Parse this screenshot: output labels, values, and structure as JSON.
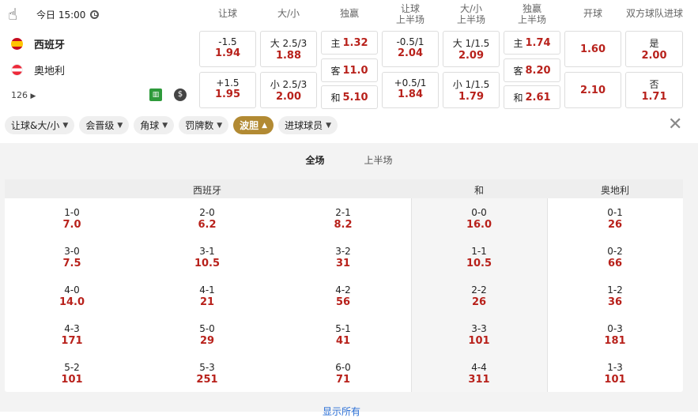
{
  "match": {
    "time": "今日 15:00",
    "home": "西班牙",
    "away": "奥地利",
    "more_markets": "126"
  },
  "icons": [
    "hand-cursor-icon",
    "clock-icon",
    "spain-flag-icon",
    "austria-flag-icon",
    "stats-icon",
    "dollar-icon",
    "close-icon"
  ],
  "columns": {
    "handicap": "让球",
    "ou": "大/小",
    "moneyline": "独赢",
    "handicap_1h_a": "让球",
    "handicap_1h_b": "上半场",
    "ou_1h_a": "大/小",
    "ou_1h_b": "上半场",
    "ml_1h_a": "独赢",
    "ml_1h_b": "上半场",
    "first_kick": "开球",
    "btts": "双方球队进球"
  },
  "odds": {
    "handicap": [
      {
        "line": "-1.5",
        "odd": "1.94"
      },
      {
        "line": "+1.5",
        "odd": "1.95"
      }
    ],
    "ou": [
      {
        "line": "大 2.5/3",
        "odd": "1.88"
      },
      {
        "line": "小 2.5/3",
        "odd": "2.00"
      }
    ],
    "moneyline": [
      {
        "line": "主",
        "odd": "1.32"
      },
      {
        "line": "客",
        "odd": "11.0"
      },
      {
        "line": "和",
        "odd": "5.10"
      }
    ],
    "handicap_1h": [
      {
        "line": "-0.5/1",
        "odd": "2.04"
      },
      {
        "line": "+0.5/1",
        "odd": "1.84"
      }
    ],
    "ou_1h": [
      {
        "line": "大 1/1.5",
        "odd": "2.09"
      },
      {
        "line": "小 1/1.5",
        "odd": "1.79"
      }
    ],
    "ml_1h": [
      {
        "line": "主",
        "odd": "1.74"
      },
      {
        "line": "客",
        "odd": "8.20"
      },
      {
        "line": "和",
        "odd": "2.61"
      }
    ],
    "first_kick": [
      {
        "odd": "1.60"
      },
      {
        "odd": "2.10"
      }
    ],
    "btts": [
      {
        "line": "是",
        "odd": "2.00"
      },
      {
        "line": "否",
        "odd": "1.71"
      }
    ]
  },
  "filters": [
    {
      "label": "让球&大/小",
      "active": false
    },
    {
      "label": "会晋级",
      "active": false
    },
    {
      "label": "角球",
      "active": false
    },
    {
      "label": "罚牌数",
      "active": false
    },
    {
      "label": "波胆",
      "active": true
    },
    {
      "label": "进球球员",
      "active": false
    }
  ],
  "period_tabs": {
    "full": "全场",
    "first_half": "上半场",
    "selected": "full"
  },
  "correct_score": {
    "headers": {
      "home": "西班牙",
      "draw": "和",
      "away": "奥地利"
    },
    "home_cols": [
      [
        {
          "s": "1-0",
          "o": "7.0"
        },
        {
          "s": "3-0",
          "o": "7.5"
        },
        {
          "s": "4-0",
          "o": "14.0"
        },
        {
          "s": "4-3",
          "o": "171"
        },
        {
          "s": "5-2",
          "o": "101"
        }
      ],
      [
        {
          "s": "2-0",
          "o": "6.2"
        },
        {
          "s": "3-1",
          "o": "10.5"
        },
        {
          "s": "4-1",
          "o": "21"
        },
        {
          "s": "5-0",
          "o": "29"
        },
        {
          "s": "5-3",
          "o": "251"
        }
      ],
      [
        {
          "s": "2-1",
          "o": "8.2"
        },
        {
          "s": "3-2",
          "o": "31"
        },
        {
          "s": "4-2",
          "o": "56"
        },
        {
          "s": "5-1",
          "o": "41"
        },
        {
          "s": "6-0",
          "o": "71"
        }
      ]
    ],
    "draw_col": [
      {
        "s": "0-0",
        "o": "16.0"
      },
      {
        "s": "1-1",
        "o": "10.5"
      },
      {
        "s": "2-2",
        "o": "26"
      },
      {
        "s": "3-3",
        "o": "101"
      },
      {
        "s": "4-4",
        "o": "311"
      }
    ],
    "away_col": [
      {
        "s": "0-1",
        "o": "26"
      },
      {
        "s": "0-2",
        "o": "66"
      },
      {
        "s": "1-2",
        "o": "36"
      },
      {
        "s": "0-3",
        "o": "181"
      },
      {
        "s": "1-3",
        "o": "101"
      }
    ]
  },
  "show_all": "显示所有"
}
